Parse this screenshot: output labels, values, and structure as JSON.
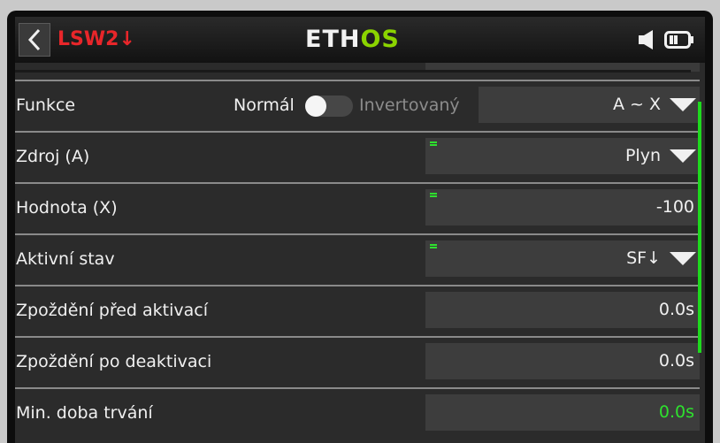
{
  "header": {
    "title": "LSW2↓",
    "logo_white": "ETH",
    "logo_green": "OS",
    "colors": {
      "title": "#e8262a",
      "logo_accent": "#8bd400",
      "scrollbar": "#1ed91e"
    },
    "icons": [
      "back-chevron-icon",
      "speaker-icon",
      "battery-icon"
    ]
  },
  "rows": [
    {
      "label": "Funkce",
      "option_a": "Normál",
      "option_b": "Invertovaný",
      "toggle_on": false,
      "value": "A ~ X"
    },
    {
      "label": "Zdroj (A)",
      "value": "Plyn"
    },
    {
      "label": "Hodnota (X)",
      "value": "-100"
    },
    {
      "label": "Aktivní stav",
      "value": "SF↓"
    },
    {
      "label": "Zpoždění před aktivací",
      "value": "0.0s"
    },
    {
      "label": "Zpoždění po deaktivaci",
      "value": "0.0s"
    },
    {
      "label": "Min. doba trvání",
      "value": "0.0s"
    }
  ]
}
